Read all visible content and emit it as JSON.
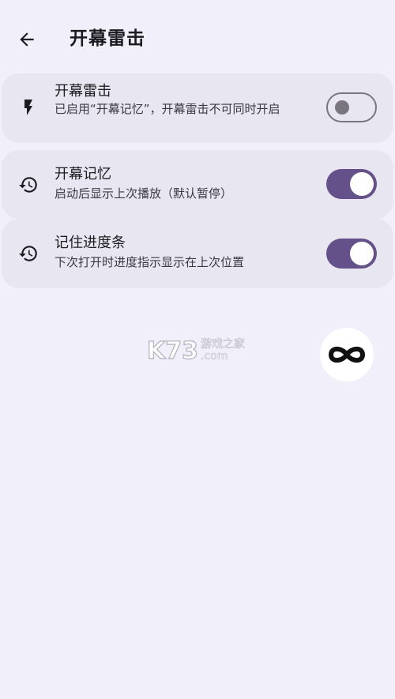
{
  "header": {
    "title": "开幕雷击",
    "back_icon": "arrow-back-icon"
  },
  "settings": [
    {
      "title": "开幕雷击",
      "description": "已启用“开幕记忆”，开幕雷击不可同时开启",
      "icon": "flash-icon",
      "enabled": false
    },
    {
      "title": "开幕记忆",
      "description": "启动后显示上次播放（默认暂停）",
      "icon": "history-icon",
      "enabled": true
    },
    {
      "title": "记住进度条",
      "description": "下次打开时进度指示显示在上次位置",
      "icon": "history-icon",
      "enabled": true
    }
  ],
  "watermark": {
    "logo": "K73",
    "cn_text": "游戏之家",
    "domain": ".com"
  },
  "floating_button": {
    "icon": "infinity-icon"
  },
  "colors": {
    "background": "#f1f0fa",
    "card": "#e8e7f1",
    "switch_on": "#645189",
    "switch_off_outline": "#79767f"
  }
}
